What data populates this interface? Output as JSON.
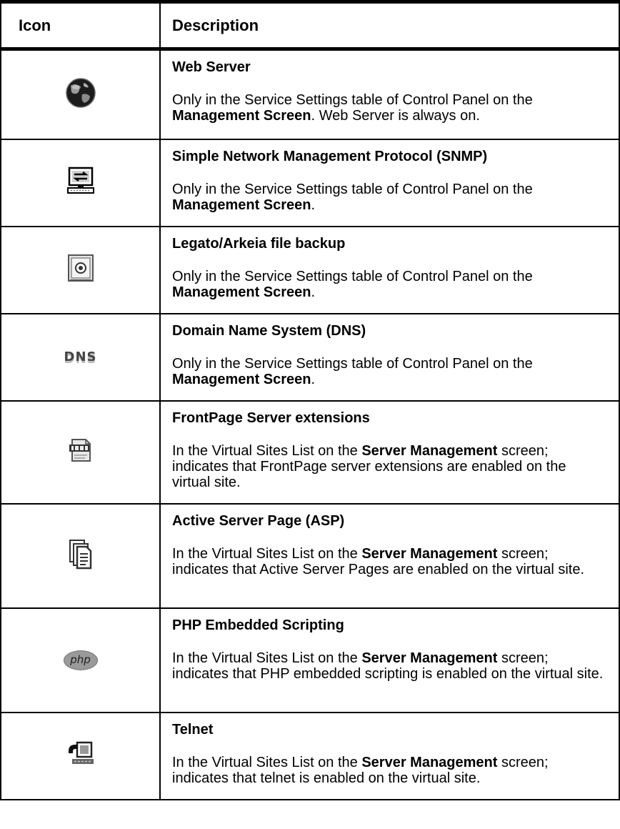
{
  "header": {
    "icon": "Icon",
    "description": "Description"
  },
  "rows": [
    {
      "icon": "web-server-globe-icon",
      "title": "Web Server",
      "pre": "Only in the Service Settings table of Control Panel on the ",
      "bold": "Management Screen",
      "post": ". Web Server is always on."
    },
    {
      "icon": "snmp-computer-icon",
      "title": "Simple Network Management Protocol (SNMP)",
      "pre": "Only in the Service Settings table of Control Panel on the ",
      "bold": "Management Screen",
      "post": "."
    },
    {
      "icon": "backup-safe-icon",
      "title": "Legato/Arkeia file backup",
      "pre": "Only in the Service Settings table of Control Panel on the ",
      "bold": "Management Screen",
      "post": "."
    },
    {
      "icon": "dns-text-icon",
      "icon_text": "DNS",
      "title": "Domain Name System (DNS)",
      "pre": "Only in the Service Settings table of Control Panel on the ",
      "bold": "Management Screen",
      "post": "."
    },
    {
      "icon": "frontpage-document-icon",
      "title": "FrontPage Server extensions",
      "pre": "In the Virtual Sites List on the ",
      "bold": "Server Management",
      "post": " screen; indicates that FrontPage server extensions are enabled on the virtual site."
    },
    {
      "icon": "asp-pages-icon",
      "title": "Active Server Page (ASP)",
      "pre": "In the Virtual Sites List on the ",
      "bold": "Server Management",
      "post": " screen; indicates that Active Server Pages are enabled on the virtual site."
    },
    {
      "icon": "php-logo-icon",
      "icon_text": "php",
      "title": "PHP Embedded Scripting",
      "pre": "In the Virtual Sites List on the ",
      "bold": "Server Management",
      "post": " screen; indicates that PHP embedded scripting is enabled on the virtual site."
    },
    {
      "icon": "telnet-terminal-icon",
      "title": "Telnet",
      "pre": "In the Virtual Sites List on the ",
      "bold": "Server Management",
      "post": " screen; indicates that telnet is enabled on the virtual site."
    }
  ]
}
